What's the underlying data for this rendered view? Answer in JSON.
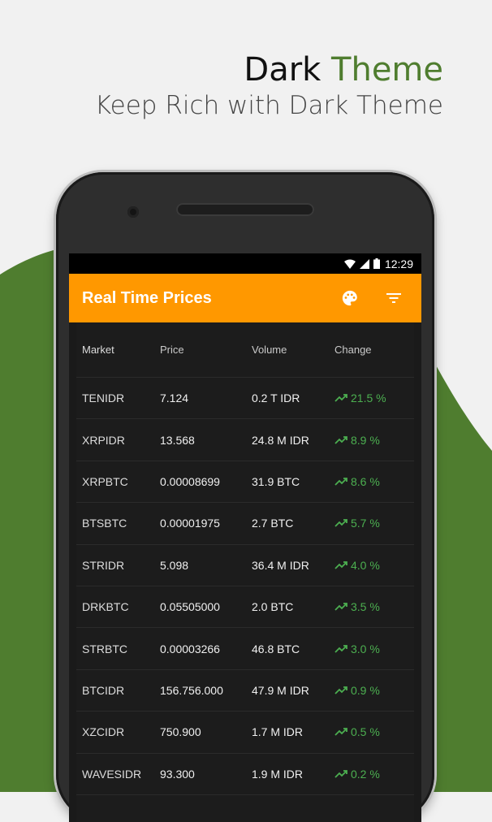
{
  "promo": {
    "title_part1": "Dark",
    "title_part2": "Theme",
    "subtitle": "Keep Rich with Dark Theme"
  },
  "colors": {
    "accent_green": "#4f7d2f",
    "appbar_orange": "#ff9800",
    "change_green": "#4caf50"
  },
  "status_bar": {
    "time": "12:29",
    "icons": [
      "wifi-icon",
      "signal-icon",
      "battery-icon"
    ]
  },
  "app_bar": {
    "title": "Real Time Prices",
    "actions": [
      "palette-icon",
      "filter-icon"
    ]
  },
  "table": {
    "headers": {
      "market": "Market",
      "price": "Price",
      "volume": "Volume",
      "change": "Change"
    },
    "rows": [
      {
        "market": "TENIDR",
        "price": "7.124",
        "volume": "0.2 T IDR",
        "change": "21.5 %"
      },
      {
        "market": "XRPIDR",
        "price": "13.568",
        "volume": "24.8 M IDR",
        "change": "8.9 %"
      },
      {
        "market": "XRPBTC",
        "price": "0.00008699",
        "volume": "31.9 BTC",
        "change": "8.6 %"
      },
      {
        "market": "BTSBTC",
        "price": "0.00001975",
        "volume": "2.7 BTC",
        "change": "5.7 %"
      },
      {
        "market": "STRIDR",
        "price": "5.098",
        "volume": "36.4 M IDR",
        "change": "4.0 %"
      },
      {
        "market": "DRKBTC",
        "price": "0.05505000",
        "volume": "2.0 BTC",
        "change": "3.5 %"
      },
      {
        "market": "STRBTC",
        "price": "0.00003266",
        "volume": "46.8 BTC",
        "change": "3.0 %"
      },
      {
        "market": "BTCIDR",
        "price": "156.756.000",
        "volume": "47.9 M IDR",
        "change": "0.9 %"
      },
      {
        "market": "XZCIDR",
        "price": "750.900",
        "volume": "1.7 M IDR",
        "change": "0.5 %"
      },
      {
        "market": "WAVESIDR",
        "price": "93.300",
        "volume": "1.9 M IDR",
        "change": "0.2 %"
      }
    ]
  }
}
